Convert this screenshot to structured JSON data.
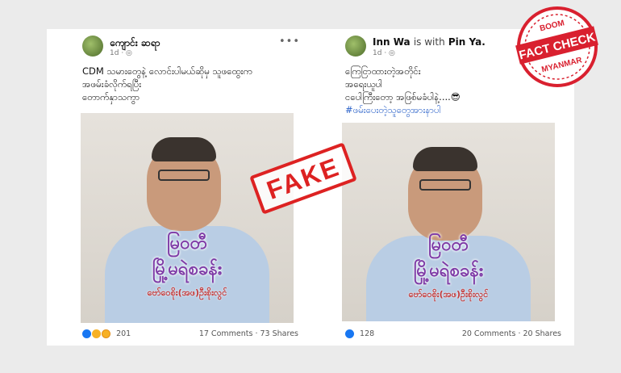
{
  "posts": [
    {
      "author": "ကျောင်း ဆရာ",
      "time": "1d",
      "text_lines": [
        "CDM သမားတွေနဲ့ လောင်းပါမယ်ဆိုမှ သူဖထွေးက",
        "အဖမ်းခံလိုက်ရပြီး",
        "တောက်နှာသကွာ"
      ],
      "overlay_title": "မြဝတီ",
      "overlay_subtitle": "မြို့မရဲစခန်း",
      "overlay_caption": "ဗော်ဝေစိုး(အဖ)ဦးစိုးလွင်",
      "reaction_count": "201",
      "comments": "17 Comments",
      "shares": "73 Shares"
    },
    {
      "author": "Inn Wa",
      "with_text": "is with",
      "with_name": "Pin Ya",
      "time": "1d",
      "text_lines": [
        "ကြေငြာထားတဲ့အတိုင်း",
        "အရေးယူပါ",
        "ငပေါကြီးတော့ အဖြစ်မခံပါနဲ့....😎"
      ],
      "hashtag": "#ဖမ်းပေးတဲ့သူတွေအားနာပါ",
      "overlay_title": "မြဝတီ",
      "overlay_subtitle": "မြို့မရဲစခန်း",
      "overlay_caption": "ဗော်ဝေစိုး(အဖ)ဦးစိုးလွင်",
      "reaction_count": "128",
      "comments": "20 Comments",
      "shares": "20 Shares"
    }
  ],
  "stamp": "FAKE",
  "badge": {
    "brand": "BOOM",
    "line1": "FACT CHECK",
    "line2": "MYANMAR",
    "color": "#d9202f"
  }
}
